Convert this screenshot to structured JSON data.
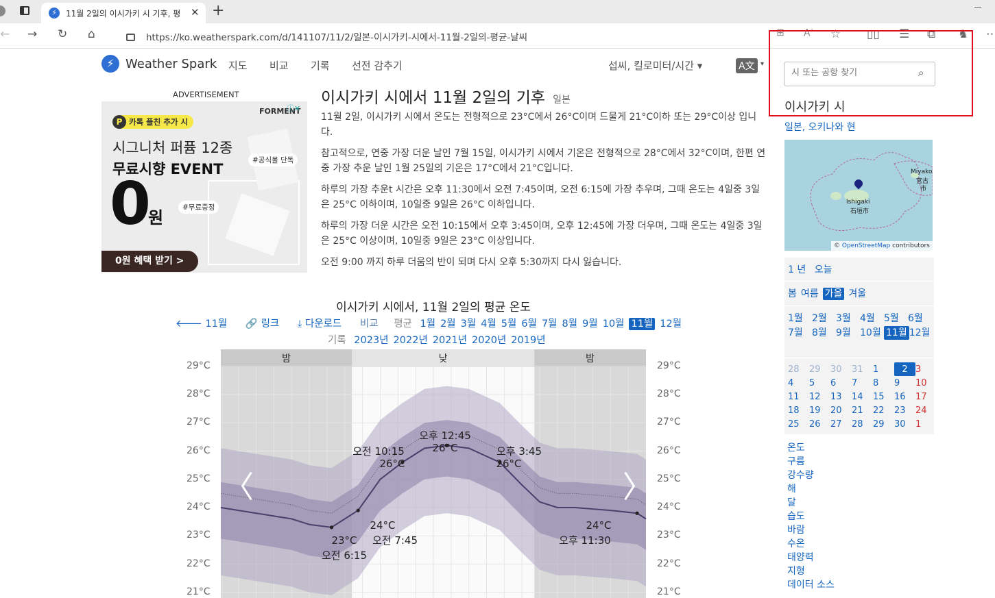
{
  "browser": {
    "tab_title": "11월 2일의 이시가키 시 기후, 평",
    "new_tab": "+",
    "url": "https://ko.weatherspark.com/d/141107/11/2/일본-이시가키-시에서-11월-2일의-평균-날씨"
  },
  "site": {
    "logo": "Weather Spark",
    "nav": [
      "지도",
      "비교",
      "기록",
      "선전 감추기"
    ],
    "units": "섭씨, 킬로미터/시간 ▾",
    "translate": "A文"
  },
  "ad": {
    "label": "ADVERTISEMENT",
    "brand": "FORMENT",
    "tag": "카톡 플친 추가 시",
    "line1": "시그니처 퍼퓸 12종",
    "line2": "무료시향 EVENT",
    "big": "0",
    "won": "원",
    "badge1": "#공식몰 단독",
    "badge2": "#무료증정",
    "cta": "0원 혜택 받기  >"
  },
  "article": {
    "title": "이시가키 시에서 11월 2일의 기후",
    "country": "일본",
    "p1": "11월 2일, 이시가키 시에서 온도는 전형적으로 23°C에서 26°C이며 드물게 21°C이하 또는 29°C이상 입니다.",
    "p2": "참고적으로, 연중 가장 더운 날인 7월 15일, 이시가키 시에서 기온은 전형적으로 28°C에서 32°C이며, 한편 연중 가장 추운 날인 1월 25일의 기온은 17°C에서 21°C입니다.",
    "p3": "하루의 가장 추운t 시간은 오후 11:30에서 오전 7:45이며, 오전 6:15에 가장 추우며, 그때 온도는 4일중 3일은 25°C 이하이며, 10일중 9일은 26°C 이하입니다.",
    "p4": "하루의 가장 더운 시간은 오전 10:15에서 오후 3:45이며, 오후 12:45에 가장 더우며, 그때 온도는 4일중 3일은 25°C 이상이며, 10일중 9일은 23°C 이상입니다.",
    "p5": "오전 9:00 까지 하루 더움의 반이 되며 다시 오후 5:30까지 다시 잃습니다."
  },
  "chart_header": {
    "title": "이시가키 시에서, 11월 2일의 평균 온도",
    "back": "11월",
    "link": "링크",
    "download": "다운로드",
    "compare": "비교",
    "avg_label": "평균",
    "months": [
      "1월",
      "2월",
      "3월",
      "4월",
      "5월",
      "6월",
      "7월",
      "8월",
      "9월",
      "10월",
      "11월",
      "12월"
    ],
    "active_month": "11월",
    "history_label": "기록",
    "years": [
      "2023년",
      "2022년",
      "2021년",
      "2020년",
      "2019년"
    ]
  },
  "chart_data": {
    "type": "line",
    "bands": [
      "밤",
      "낮",
      "밤"
    ],
    "y_ticks": [
      "29°C",
      "28°C",
      "27°C",
      "26°C",
      "25°C",
      "24°C",
      "23°C",
      "22°C",
      "21°C"
    ],
    "ylim": [
      20.8,
      29.6
    ],
    "xlim_hours": [
      0,
      24
    ],
    "series": [
      {
        "x": [
          0,
          1,
          2,
          3,
          4,
          5,
          6.25,
          7.75,
          9,
          10.25,
          11.5,
          12.75,
          14,
          15.75,
          17,
          18,
          19,
          20,
          21,
          22,
          23.5,
          24
        ],
        "values": [
          24.0,
          23.9,
          23.8,
          23.7,
          23.6,
          23.4,
          23.3,
          23.9,
          25.0,
          25.6,
          26.1,
          26.2,
          26.1,
          25.6,
          24.8,
          24.2,
          24.0,
          24.0,
          23.95,
          23.9,
          23.8,
          23.6
        ]
      }
    ],
    "annotations": [
      {
        "time": "오전 6:15",
        "temp": "23°C"
      },
      {
        "time": "오전 7:45",
        "temp": "24°C"
      },
      {
        "time": "오전 10:15",
        "temp": "26°C"
      },
      {
        "time": "오후 12:45",
        "temp": "26°C"
      },
      {
        "time": "오후 3:45",
        "temp": "26°C"
      },
      {
        "time": "오후 11:30",
        "temp": "24°C"
      }
    ]
  },
  "sidebar": {
    "search_placeholder": "시 또는 공항 찾기",
    "city": "이시가키 시",
    "region": "일본, 오키나와 현",
    "map_label1": "Ishigaki",
    "map_label2": "石垣市",
    "map_label3": "Miyako",
    "map_label4": "宮古",
    "map_label5": "市",
    "map_credit_prefix": "© ",
    "map_credit_link": "OpenStreetMap",
    "map_credit_suffix": " contributors",
    "year_row": [
      "1 년",
      "오늘"
    ],
    "seasons": [
      "봄",
      "여름",
      "가을",
      "겨울"
    ],
    "active_season": "가을",
    "months": [
      "1월",
      "2월",
      "3월",
      "4월",
      "5월",
      "6월",
      "7월",
      "8월",
      "9월",
      "10월",
      "11월",
      "12월"
    ],
    "active_month": "11월",
    "calendar": [
      [
        "28",
        "29",
        "30",
        "31",
        "1",
        "2",
        "3"
      ],
      [
        "4",
        "5",
        "6",
        "7",
        "8",
        "9",
        "10"
      ],
      [
        "11",
        "12",
        "13",
        "14",
        "15",
        "16",
        "17"
      ],
      [
        "18",
        "19",
        "20",
        "21",
        "22",
        "23",
        "24"
      ],
      [
        "25",
        "26",
        "27",
        "28",
        "29",
        "30",
        "1"
      ]
    ],
    "active_day": "2",
    "links": [
      "온도",
      "구름",
      "강수량",
      "해",
      "달",
      "습도",
      "바람",
      "수온",
      "태양력",
      "지형",
      "데이터 소스"
    ]
  },
  "colors": {
    "accent": "#1565c0",
    "highlight_box": "#e0101e",
    "line": "#4a3f6b"
  }
}
